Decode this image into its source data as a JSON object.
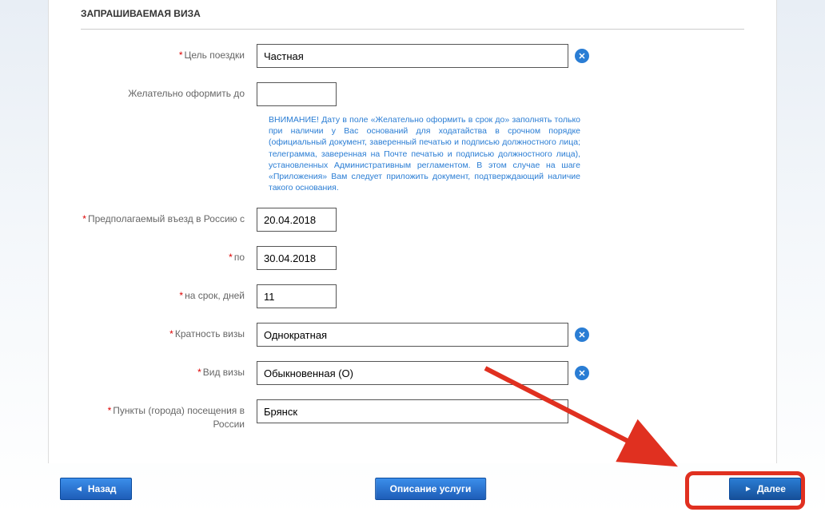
{
  "section_title": "ЗАПРАШИВАЕМАЯ ВИЗА",
  "fields": {
    "purpose": {
      "label": "Цель поездки",
      "value": "Частная",
      "required": true
    },
    "deadline": {
      "label": "Желательно оформить до",
      "value": "",
      "required": false
    },
    "hint": "ВНИМАНИЕ! Дату в поле «Желательно оформить в срок до» заполнять только при наличии у Вас оснований для ходатайства в срочном порядке (официальный документ, заверенный печатью и подписью должностного лица; телеграмма, заверенная на Почте печатью и подписью должностного лица), установленных Административным регламентом. В этом случае на шаге «Приложения» Вам следует приложить документ, подтверждающий наличие такого основания.",
    "entry_from": {
      "label": "Предполагаемый въезд в Россию с",
      "value": "20.04.2018",
      "required": true
    },
    "entry_to": {
      "label": "по",
      "value": "30.04.2018",
      "required": true
    },
    "duration": {
      "label": "на срок, дней",
      "value": "11",
      "required": true
    },
    "multiplicity": {
      "label": "Кратность визы",
      "value": "Однократная",
      "required": true
    },
    "visa_type": {
      "label": "Вид визы",
      "value": "Обыкновенная (О)",
      "required": true
    },
    "cities": {
      "label": "Пункты (города) посещения в России",
      "value": "Брянск",
      "required": true
    }
  },
  "buttons": {
    "back": "Назад",
    "describe": "Описание услуги",
    "next": "Далее"
  }
}
